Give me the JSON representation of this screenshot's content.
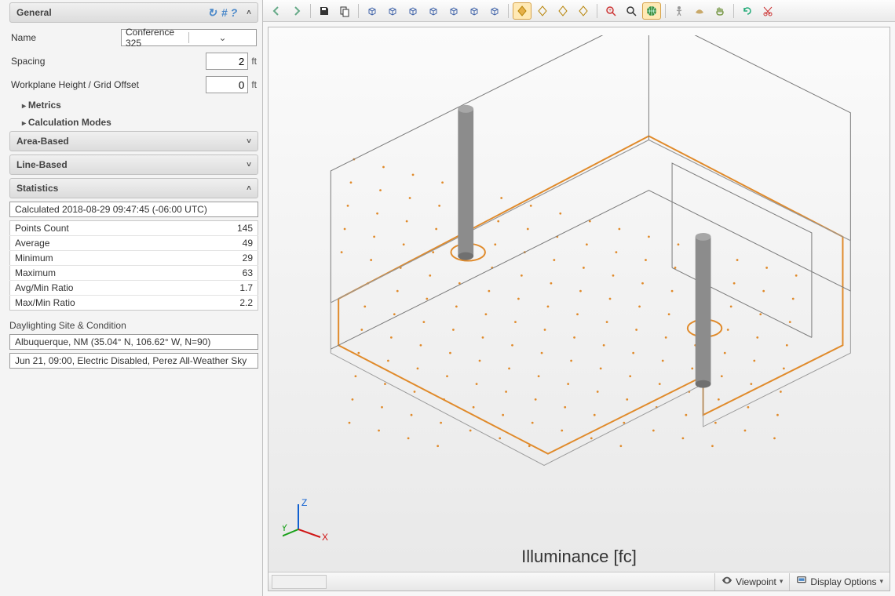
{
  "sidebar": {
    "sections": {
      "general": {
        "title": "General",
        "expanded": true
      },
      "areaBased": {
        "title": "Area-Based",
        "expanded": false
      },
      "lineBased": {
        "title": "Line-Based",
        "expanded": false
      },
      "statistics": {
        "title": "Statistics",
        "expanded": true
      }
    },
    "general": {
      "nameLabel": "Name",
      "nameValue": "Conference 325",
      "spacingLabel": "Spacing",
      "spacingValue": "2",
      "spacingUnit": "ft",
      "workplaneLabel": "Workplane Height / Grid Offset",
      "workplaneValue": "0",
      "workplaneUnit": "ft",
      "metricsLabel": "Metrics",
      "calcModesLabel": "Calculation Modes"
    },
    "statistics": {
      "calculatedLine": "Calculated 2018-08-29 09:47:45 (-06:00 UTC)",
      "rows": [
        {
          "label": "Points Count",
          "value": "145"
        },
        {
          "label": "Average",
          "value": "49"
        },
        {
          "label": "Minimum",
          "value": "29"
        },
        {
          "label": "Maximum",
          "value": "63"
        },
        {
          "label": "Avg/Min Ratio",
          "value": "1.7"
        },
        {
          "label": "Max/Min Ratio",
          "value": "2.2"
        }
      ],
      "siteHeader": "Daylighting Site & Condition",
      "siteLine": "Albuquerque, NM (35.04° N, 106.62° W, N=90)",
      "condLine": "Jun 21, 09:00, Electric Disabled, Perez All-Weather Sky"
    }
  },
  "toolbar": {
    "items": [
      {
        "name": "nav-back-icon",
        "group": 0
      },
      {
        "name": "nav-forward-icon",
        "group": 0
      },
      {
        "name": "save-icon",
        "group": 1
      },
      {
        "name": "copy-icon",
        "group": 1
      },
      {
        "name": "view-iso-nw-icon",
        "group": 2
      },
      {
        "name": "view-iso-ne-icon",
        "group": 2
      },
      {
        "name": "view-iso-sw-icon",
        "group": 2
      },
      {
        "name": "view-iso-se-icon",
        "group": 2
      },
      {
        "name": "view-top-icon",
        "group": 2
      },
      {
        "name": "view-front-icon",
        "group": 2
      },
      {
        "name": "view-side-icon",
        "group": 2
      },
      {
        "name": "render-solid-icon",
        "group": 3,
        "selected": true
      },
      {
        "name": "render-wire-icon",
        "group": 3
      },
      {
        "name": "render-hidden-icon",
        "group": 3
      },
      {
        "name": "render-shaded-icon",
        "group": 3
      },
      {
        "name": "zoom-extents-icon",
        "group": 4
      },
      {
        "name": "zoom-window-icon",
        "group": 4
      },
      {
        "name": "globe-icon",
        "group": 4,
        "selected": true
      },
      {
        "name": "walk-icon",
        "group": 5
      },
      {
        "name": "fly-icon",
        "group": 5
      },
      {
        "name": "pan-hand-icon",
        "group": 5
      },
      {
        "name": "refresh-icon",
        "group": 6
      },
      {
        "name": "cut-icon",
        "group": 6
      }
    ]
  },
  "viewport": {
    "caption": "Illuminance [fc]",
    "axes": {
      "x": "X",
      "y": "Y",
      "z": "Z"
    }
  },
  "footer": {
    "viewpointLabel": "Viewpoint",
    "displayOptionsLabel": "Display Options"
  }
}
